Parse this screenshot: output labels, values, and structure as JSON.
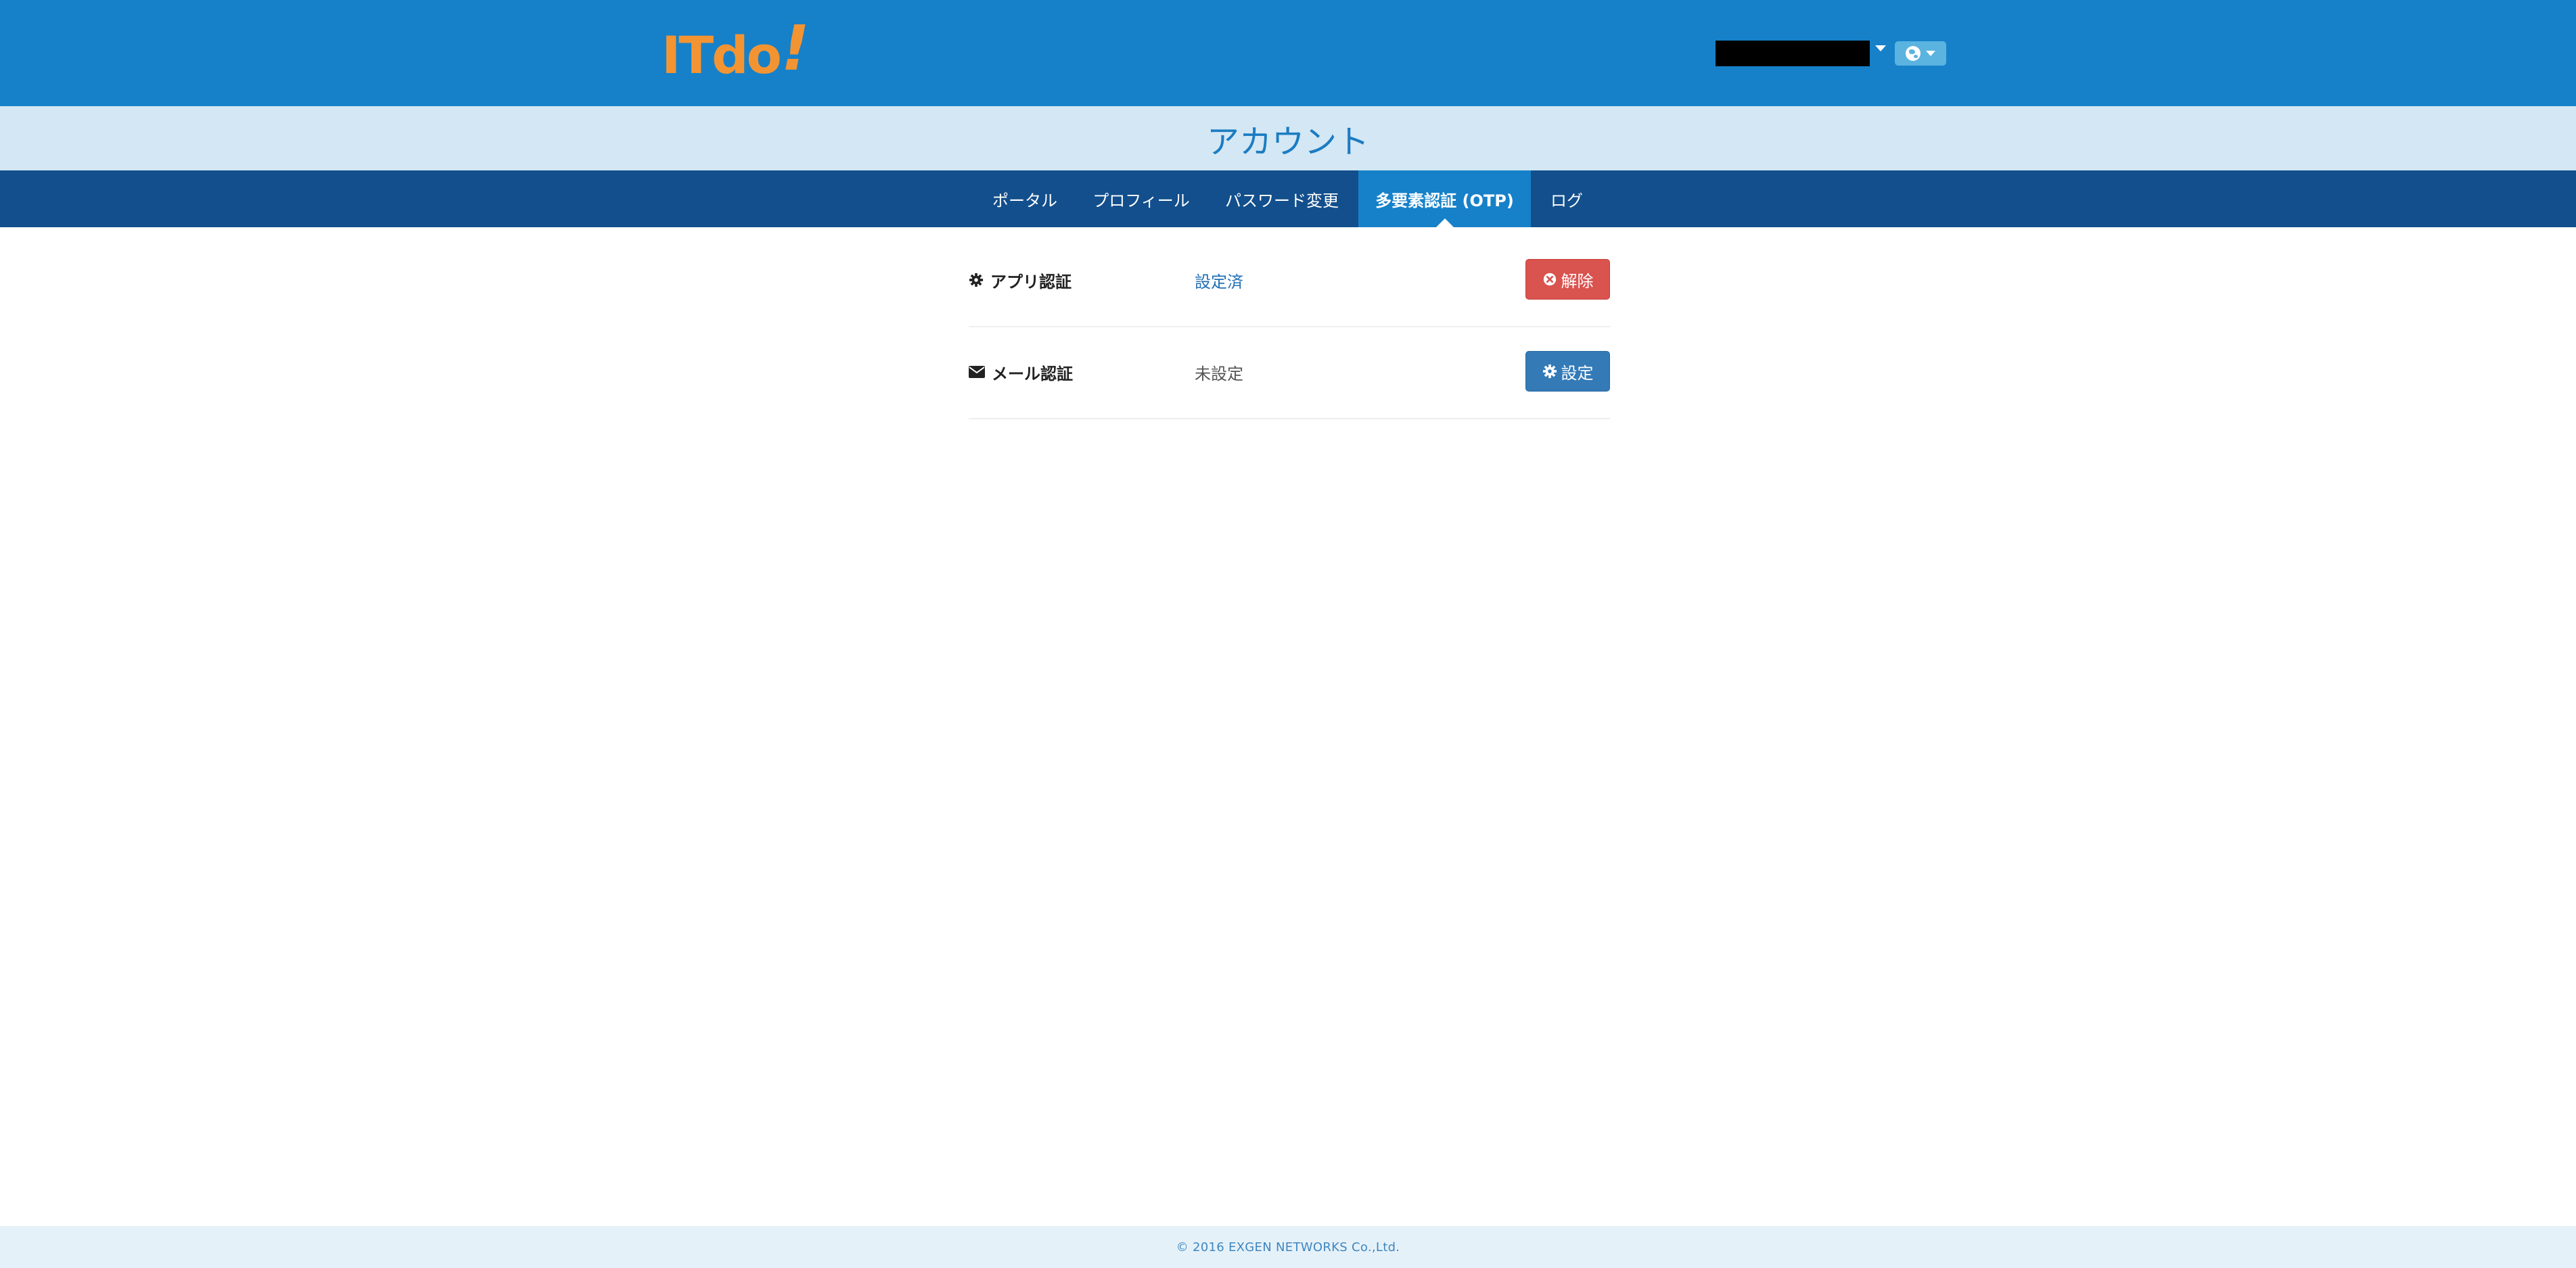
{
  "header": {
    "logo_text": "ITdo",
    "logo_mark": "!",
    "user_menu_caret_icon": "caret-down-icon",
    "language_icon": "globe-icon",
    "language_caret_icon": "caret-down-icon",
    "brand_color": "#1681c9",
    "logo_color": "#f39433"
  },
  "page": {
    "title": "アカウント"
  },
  "nav": {
    "tabs": [
      {
        "label": "ポータル",
        "active": false
      },
      {
        "label": "プロフィール",
        "active": false
      },
      {
        "label": "パスワード変更",
        "active": false
      },
      {
        "label": "多要素認証 (OTP)",
        "active": true
      },
      {
        "label": "ログ",
        "active": false
      }
    ]
  },
  "otp": {
    "rows": [
      {
        "icon": "gear-icon",
        "label": "アプリ認証",
        "status": "設定済",
        "button_label": "解除",
        "button_icon": "x-circle-icon",
        "button_color": "#d9534f"
      },
      {
        "icon": "envelope-icon",
        "label": "メール認証",
        "status": "未設定",
        "button_label": "設定",
        "button_icon": "gear-icon",
        "button_color": "#337ab7"
      }
    ]
  },
  "footer": {
    "copyright": "© 2016 EXGEN NETWORKS Co.,Ltd."
  }
}
